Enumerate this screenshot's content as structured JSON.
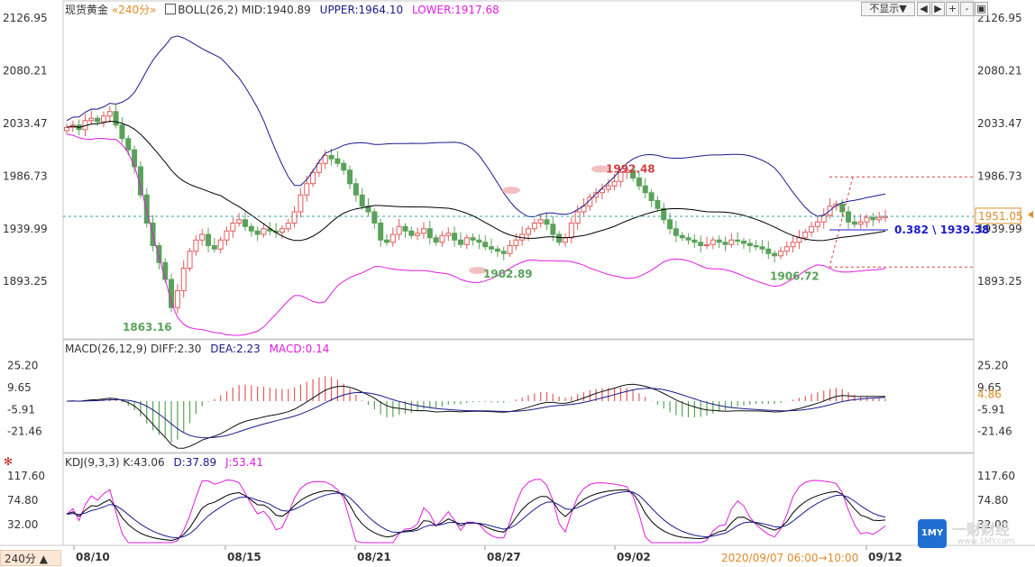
{
  "header": {
    "symbol": "现货黄金",
    "timeframe": "«240分»",
    "boll_label": "BOLL(26,2)",
    "boll_mid": "MID:1940.89",
    "boll_upper": "UPPER:1964.10",
    "boll_lower": "LOWER:1917.68",
    "macd_label": "MACD(26,12,9)",
    "macd_diff": "DIFF:2.30",
    "macd_dea": "DEA:2.23",
    "macd_macd": "MACD:0.14",
    "kdj_label": "KDJ(9,3,3)",
    "kdj_k": "K:43.06",
    "kdj_d": "D:37.89",
    "kdj_j": "J:53.41"
  },
  "controls": {
    "display_select": "不显示▼",
    "prev": "◀",
    "next": "▶",
    "zoom_in": "+",
    "zoom_out": "-",
    "restore": "▣",
    "close": "✕"
  },
  "timeframe_button": "240分 ▲",
  "timestamp": "2020/09/07 06:00→10:00",
  "fib": {
    "ratio": "0.382",
    "value": "1939.38"
  },
  "last_price_tag": "1951.05",
  "macd_tag": "4.86",
  "logo": {
    "badge": "1MY",
    "name": "一财财经",
    "url": "www.1MY.com"
  },
  "colors": {
    "up": "#e05c5c",
    "down": "#5aa25a",
    "boll_mid": "#000000",
    "boll_upper": "#1a1a8c",
    "boll_lower": "#e01ce0",
    "diff": "#111111",
    "dea": "#1a1a8c",
    "k": "#000000",
    "d": "#1a1a8c",
    "j": "#e01ce0",
    "dashed": "#3aa0a0"
  },
  "chart_data": [
    {
      "type": "candlestick",
      "title": "现货黄金",
      "ylim": [
        1850,
        2140
      ],
      "y_ticks": [
        "2126.95",
        "2080.21",
        "2033.47",
        "1986.73",
        "1939.99",
        "1893.25"
      ],
      "x_ticks": [
        "08/10",
        "08/15",
        "08/21",
        "08/27",
        "09/02",
        "09/12"
      ],
      "annotations": [
        "1863.16",
        "1992.48",
        "1902.89",
        "1906.72"
      ],
      "close": [
        2030,
        2032,
        2028,
        2036,
        2038,
        2035,
        2040,
        2044,
        2032,
        2020,
        2010,
        1995,
        1970,
        1945,
        1925,
        1910,
        1895,
        1870,
        1885,
        1905,
        1920,
        1930,
        1935,
        1925,
        1922,
        1930,
        1938,
        1945,
        1948,
        1942,
        1938,
        1935,
        1940,
        1938,
        1937,
        1940,
        1945,
        1955,
        1970,
        1980,
        1990,
        1998,
        2005,
        2002,
        1998,
        1992,
        1980,
        1970,
        1960,
        1955,
        1945,
        1930,
        1928,
        1935,
        1942,
        1938,
        1934,
        1936,
        1940,
        1932,
        1928,
        1934,
        1936,
        1930,
        1926,
        1932,
        1930,
        1928,
        1924,
        1922,
        1920,
        1918,
        1925,
        1930,
        1935,
        1940,
        1945,
        1948,
        1944,
        1935,
        1928,
        1932,
        1945,
        1955,
        1960,
        1968,
        1972,
        1975,
        1978,
        1982,
        1990,
        1992,
        1985,
        1978,
        1972,
        1965,
        1958,
        1948,
        1940,
        1934,
        1932,
        1930,
        1928,
        1925,
        1926,
        1930,
        1928,
        1926,
        1930,
        1929,
        1927,
        1925,
        1924,
        1922,
        1918,
        1916,
        1920,
        1924,
        1928,
        1932,
        1937,
        1942,
        1946,
        1952,
        1960,
        1962,
        1955,
        1946,
        1944,
        1946,
        1950,
        1948,
        1950,
        1951
      ],
      "bollinger": {
        "mid": 1940.89,
        "upper": 1964.1,
        "lower": 1917.68
      },
      "last_price": 1951.05
    },
    {
      "type": "bar",
      "title": "MACD(26,12,9)",
      "ylim": [
        -30,
        30
      ],
      "y_ticks": [
        "25.20",
        "9.65",
        "-5.91",
        "-21.46"
      ],
      "series": [
        {
          "name": "DIFF",
          "last": 2.3
        },
        {
          "name": "DEA",
          "last": 2.23
        },
        {
          "name": "MACD",
          "last": 0.14
        }
      ]
    },
    {
      "type": "line",
      "title": "KDJ(9,3,3)",
      "ylim": [
        0,
        130
      ],
      "y_ticks": [
        "117.60",
        "74.80",
        "32.00"
      ],
      "series": [
        {
          "name": "K",
          "last": 43.06
        },
        {
          "name": "D",
          "last": 37.89
        },
        {
          "name": "J",
          "last": 53.41
        }
      ]
    }
  ]
}
